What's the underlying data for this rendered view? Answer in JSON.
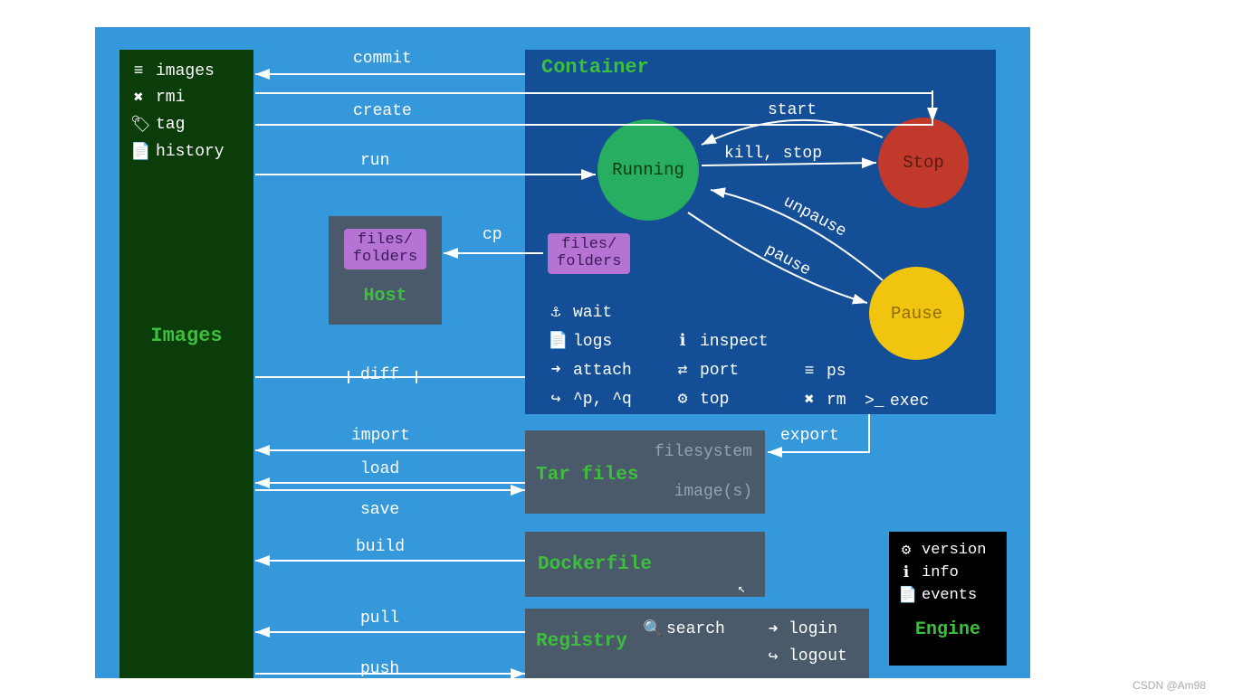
{
  "images_panel": {
    "title": "Images",
    "items": [
      {
        "icon": "≡",
        "label": "images"
      },
      {
        "icon": "✖",
        "label": "rmi"
      },
      {
        "icon": "🏷",
        "label": "tag"
      },
      {
        "icon": "📄",
        "label": "history"
      }
    ]
  },
  "container": {
    "title": "Container",
    "states": {
      "running": "Running",
      "stop": "Stop",
      "pause": "Pause"
    },
    "files_folders": "files/\nfolders",
    "commands_col1": [
      {
        "icon": "⚓",
        "label": "wait"
      },
      {
        "icon": "📄",
        "label": "logs"
      },
      {
        "icon": "➜",
        "label": "attach"
      },
      {
        "icon": "↪",
        "label": "^p, ^q"
      }
    ],
    "commands_col2": [
      {
        "icon": "ℹ",
        "label": "inspect"
      },
      {
        "icon": "⇄",
        "label": "port"
      },
      {
        "icon": "⚙",
        "label": "top"
      }
    ],
    "commands_col3": [
      {
        "icon": "≡",
        "label": "ps"
      },
      {
        "icon": "✖",
        "label": "rm"
      }
    ],
    "commands_col4": [
      {
        "icon": ">_",
        "label": "exec"
      }
    ]
  },
  "host": {
    "title": "Host",
    "files_folders": "files/\nfolders"
  },
  "tar": {
    "title": "Tar files",
    "line1": "filesystem",
    "line2": "image(s)"
  },
  "dockerfile": {
    "title": "Dockerfile"
  },
  "registry": {
    "title": "Registry",
    "search": "search",
    "login": "login",
    "logout": "logout"
  },
  "engine": {
    "title": "Engine",
    "items": [
      {
        "icon": "⚙",
        "label": "version"
      },
      {
        "icon": "ℹ",
        "label": "info"
      },
      {
        "icon": "📄",
        "label": "events"
      }
    ]
  },
  "edges": {
    "commit": "commit",
    "create": "create",
    "run": "run",
    "start": "start",
    "kill_stop": "kill, stop",
    "unpause": "unpause",
    "pause": "pause",
    "cp": "cp",
    "diff": "diff",
    "import": "import",
    "export": "export",
    "load": "load",
    "save": "save",
    "build": "build",
    "pull": "pull",
    "push": "push"
  },
  "watermark": "CSDN @Am98"
}
